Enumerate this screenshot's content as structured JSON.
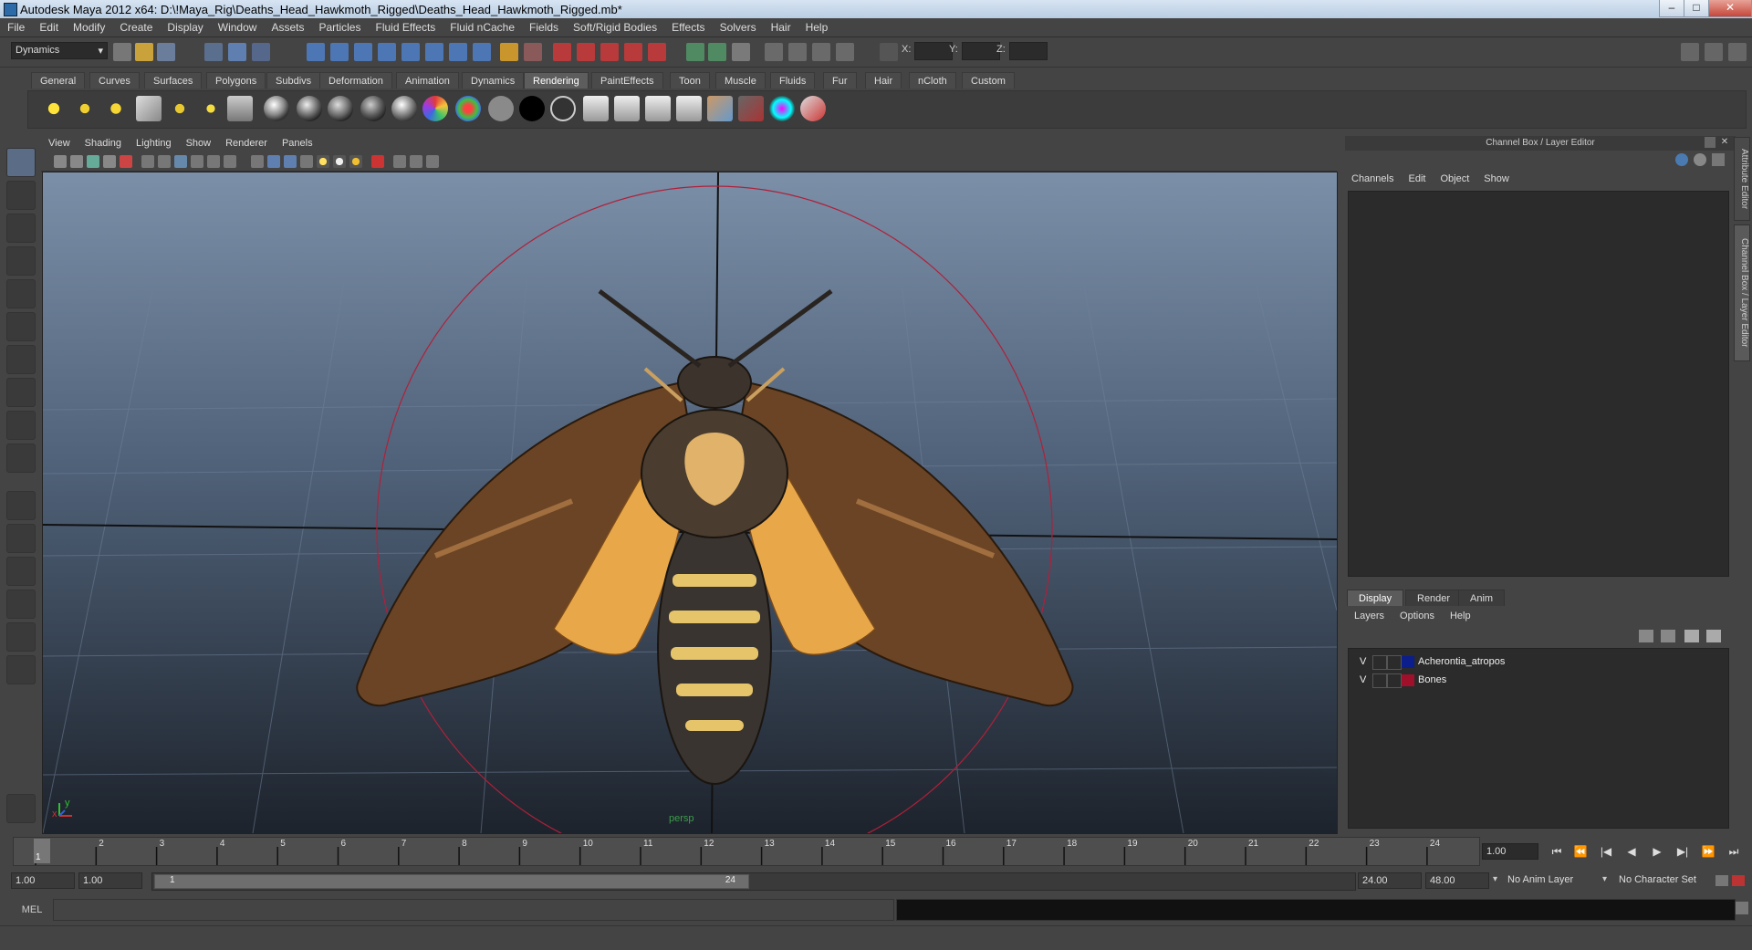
{
  "window": {
    "title": "Autodesk Maya 2012 x64: D:\\!Maya_Rig\\Deaths_Head_Hawkmoth_Rigged\\Deaths_Head_Hawkmoth_Rigged.mb*",
    "minimize": "–",
    "maximize": "□",
    "close": "✕"
  },
  "menubar": [
    "File",
    "Edit",
    "Modify",
    "Create",
    "Display",
    "Window",
    "Assets",
    "Particles",
    "Fluid Effects",
    "Fluid nCache",
    "Fields",
    "Soft/Rigid Bodies",
    "Effects",
    "Solvers",
    "Hair",
    "Help"
  ],
  "statusline": {
    "menuset": "Dynamics",
    "x_label": "X:",
    "y_label": "Y:",
    "z_label": "Z:"
  },
  "shelf": {
    "tabs": [
      "General",
      "Curves",
      "Surfaces",
      "Polygons",
      "Subdivs",
      "Deformation",
      "Animation",
      "Dynamics",
      "Rendering",
      "PaintEffects",
      "Toon",
      "Muscle",
      "Fluids",
      "Fur",
      "Hair",
      "nCloth",
      "Custom"
    ],
    "active_tab": "Rendering",
    "icons": [
      "point-light-icon",
      "spot-light-icon",
      "area-light-icon",
      "directional-light-icon",
      "volume-light-icon",
      "ambient-light-icon",
      "ipr-render-icon",
      "blinn-sphere-icon",
      "lambert-sphere-icon",
      "phong-sphere-icon",
      "phong-e-sphere-icon",
      "anisotropic-sphere-icon",
      "ramp-sphere-icon",
      "layered-sphere-icon",
      "gray-sphere-icon",
      "black-sphere-icon",
      "dark-sphere-icon",
      "render-view-icon",
      "render-current-icon",
      "ipr-icon",
      "render-settings-icon",
      "hypershade-icon",
      "batch-render-icon",
      "render-globals-icon",
      "paint-icon"
    ]
  },
  "viewport": {
    "menu": [
      "View",
      "Shading",
      "Lighting",
      "Show",
      "Renderer",
      "Panels"
    ],
    "camera_label": "persp",
    "axis_y": "y",
    "axis_x": "x"
  },
  "channel_box": {
    "title": "Channel Box / Layer Editor",
    "menu": [
      "Channels",
      "Edit",
      "Object",
      "Show"
    ]
  },
  "layer_editor": {
    "tabs": [
      "Display",
      "Render",
      "Anim"
    ],
    "active_tab": "Display",
    "menu": [
      "Layers",
      "Options",
      "Help"
    ],
    "layers": [
      {
        "visible": "V",
        "name": "Acherontia_atropos",
        "color": "#0b1e8c"
      },
      {
        "visible": "V",
        "name": "Bones",
        "color": "#a0102a"
      }
    ]
  },
  "side_tabs": {
    "attribute_editor": "Attribute Editor",
    "channel_box": "Channel Box / Layer Editor"
  },
  "timeline": {
    "ticks": [
      1,
      2,
      3,
      4,
      5,
      6,
      7,
      8,
      9,
      10,
      11,
      12,
      13,
      14,
      15,
      16,
      17,
      18,
      19,
      20,
      21,
      22,
      23,
      24
    ],
    "current_frame_marker": "1",
    "current_time": "1.00",
    "playback": [
      "⏮",
      "⏪",
      "|◀",
      "◀",
      "▶",
      "▶|",
      "⏩",
      "⏭"
    ]
  },
  "range": {
    "start": "1.00",
    "playback_start": "1.00",
    "handle_start": "1",
    "handle_end": "24",
    "playback_end": "24.00",
    "end": "48.00",
    "anim_layer": "No Anim Layer",
    "character_set": "No Character Set"
  },
  "command": {
    "label": "MEL"
  }
}
